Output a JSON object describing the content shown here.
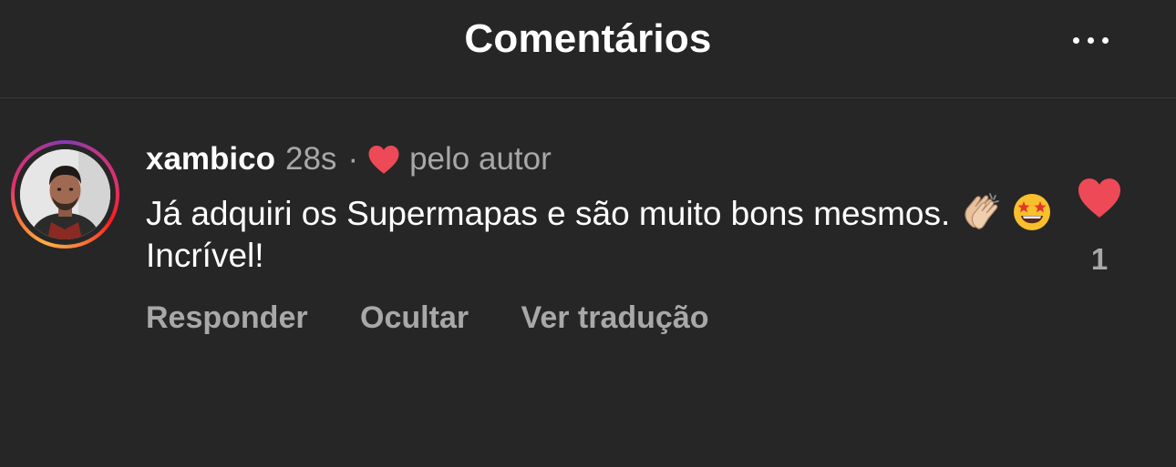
{
  "header": {
    "title": "Comentários",
    "more_icon": "more-horizontal-icon"
  },
  "comment": {
    "username": "xambico",
    "time": "28s",
    "separator": "·",
    "liked_by_author_label": "pelo autor",
    "liked_by_author_icon": "heart-icon",
    "text_part1": "Já adquiri os Supermapas e são muito bons mesmos.",
    "emoji1": "clapping-hands-emoji",
    "emoji2": "star-struck-emoji",
    "text_part2": "Incrível!",
    "avatar_icon": "user-avatar",
    "like_icon": "heart-filled-icon",
    "like_count": "1",
    "actions": {
      "reply": "Responder",
      "hide": "Ocultar",
      "translate": "Ver tradução"
    }
  },
  "colors": {
    "background": "#262626",
    "text_primary": "#ffffff",
    "text_secondary": "#a8a8a8",
    "heart": "#ed4956"
  }
}
